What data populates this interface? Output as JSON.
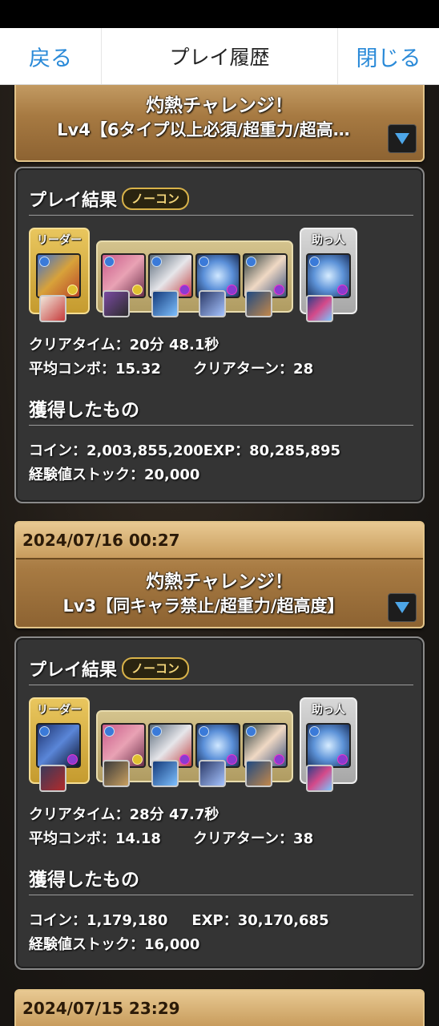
{
  "nav": {
    "back": "戻る",
    "title": "プレイ履歴",
    "close": "閉じる"
  },
  "entries": [
    {
      "date": "",
      "dungeon": "灼熱チャレンジ！",
      "floor": "Lv4【6タイプ以上必須/超重力/超高…",
      "result_heading": "プレイ結果",
      "badge": "ノーコン",
      "leader_label": "リーダー",
      "helper_label": "助っ人",
      "clear_time_label": "クリアタイム：",
      "clear_time": "20分 48.1秒",
      "avg_combo_label": "平均コンボ：",
      "avg_combo": "15.32",
      "clear_turn_label": "クリアターン：",
      "clear_turn": "28",
      "obtained_heading": "獲得したもの",
      "coin_label": "コイン：",
      "coin": "2,003,855,200",
      "exp_label": "EXP：",
      "exp": "80,285,895",
      "stock_label": "経験値ストック：",
      "stock": "20,000"
    },
    {
      "date": "2024/07/16 00:27",
      "dungeon": "灼熱チャレンジ！",
      "floor": "Lv3【同キャラ禁止/超重力/超高度】",
      "result_heading": "プレイ結果",
      "badge": "ノーコン",
      "leader_label": "リーダー",
      "helper_label": "助っ人",
      "clear_time_label": "クリアタイム：",
      "clear_time": "28分 47.7秒",
      "avg_combo_label": "平均コンボ：",
      "avg_combo": "14.18",
      "clear_turn_label": "クリアターン：",
      "clear_turn": "38",
      "obtained_heading": "獲得したもの",
      "coin_label": "コイン：",
      "coin": "1,179,180",
      "exp_label": "EXP：",
      "exp": "30,170,685",
      "stock_label": "経験値ストック：",
      "stock": "16,000"
    },
    {
      "date": "2024/07/15 23:29"
    }
  ],
  "colors": {
    "accent": "#2a8ad8",
    "banner": "#a77a42",
    "card": "#343434",
    "badge": "#d9b34a"
  }
}
